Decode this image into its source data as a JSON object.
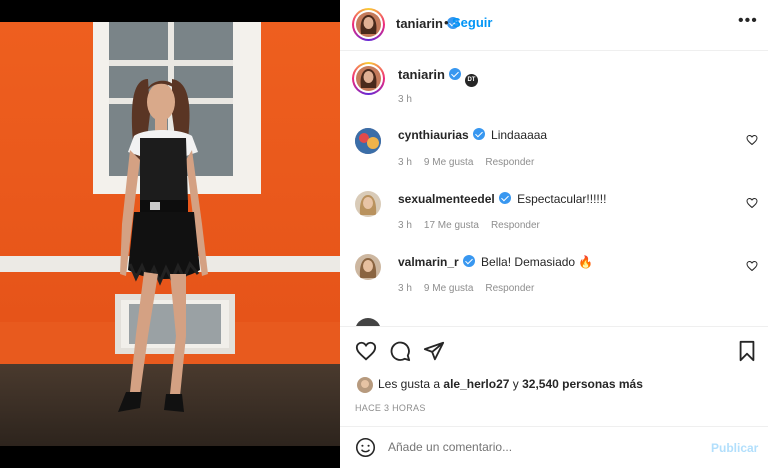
{
  "post": {
    "author": "taniarin",
    "follow_label": "Seguir",
    "separator": "•",
    "more_label": "•••",
    "caption_badge": "DT",
    "caption_time": "3 h"
  },
  "comments": [
    {
      "user": "cynthiaurias",
      "text": "Lindaaaaa",
      "time": "3 h",
      "likes": "9 Me gusta",
      "reply": "Responder"
    },
    {
      "user": "sexualmenteedel",
      "text": "Espectacular!!!!!!",
      "time": "3 h",
      "likes": "17 Me gusta",
      "reply": "Responder"
    },
    {
      "user": "valmarin_r",
      "text": "Bella! Demasiado 🔥",
      "time": "3 h",
      "likes": "9 Me gusta",
      "reply": "Responder"
    }
  ],
  "likes": {
    "prefix": "Les gusta a",
    "user": "ale_herlo27",
    "connector": "y",
    "count": "32,540 personas más"
  },
  "posted_ago": "HACE 3 HORAS",
  "add_comment": {
    "placeholder": "Añade un comentario...",
    "publish_label": "Publicar"
  },
  "colors": {
    "accent": "#0095f6",
    "verified": "#3897f0",
    "wall_orange": "#e85a1e"
  }
}
